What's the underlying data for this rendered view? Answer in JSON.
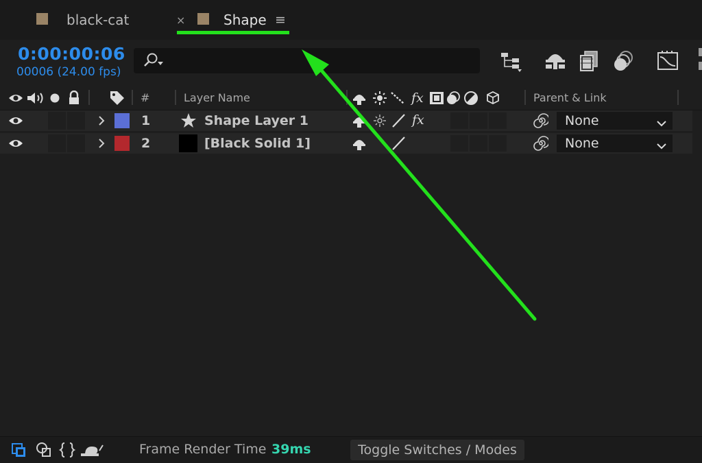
{
  "tabs": [
    {
      "label": "black-cat",
      "active": false
    },
    {
      "label": "Shape",
      "active": true,
      "close_glyph": "×",
      "menu_glyph": "≡"
    }
  ],
  "timecode": "0:00:00:06",
  "frame_info": "00006 (24.00 fps)",
  "search": {
    "placeholder": "",
    "value": ""
  },
  "toolbar_icons": [
    "composition-flowchart-icon",
    "draft-3d-icon",
    "frame-blending-icon",
    "motion-blur-icon",
    "graph-editor-icon"
  ],
  "columns": {
    "number": "#",
    "layer_name": "Layer Name",
    "parent_link": "Parent & Link"
  },
  "layers": [
    {
      "number": "1",
      "name": "Shape Layer 1",
      "label_color": "#5b6fd6",
      "type": "shape",
      "fx": "fx",
      "parent": "None"
    },
    {
      "number": "2",
      "name": "[Black Solid 1]",
      "label_color": "#b3282d",
      "type": "solid",
      "parent": "None"
    }
  ],
  "bottom": {
    "frame_render_label": "Frame Render Time",
    "frame_render_value": "39ms",
    "toggle_label": "Toggle Switches / Modes"
  },
  "colors": {
    "accent_timecode": "#2d8ceb",
    "annotation_arrow": "#23e01c",
    "render_time": "#35d6b0"
  }
}
